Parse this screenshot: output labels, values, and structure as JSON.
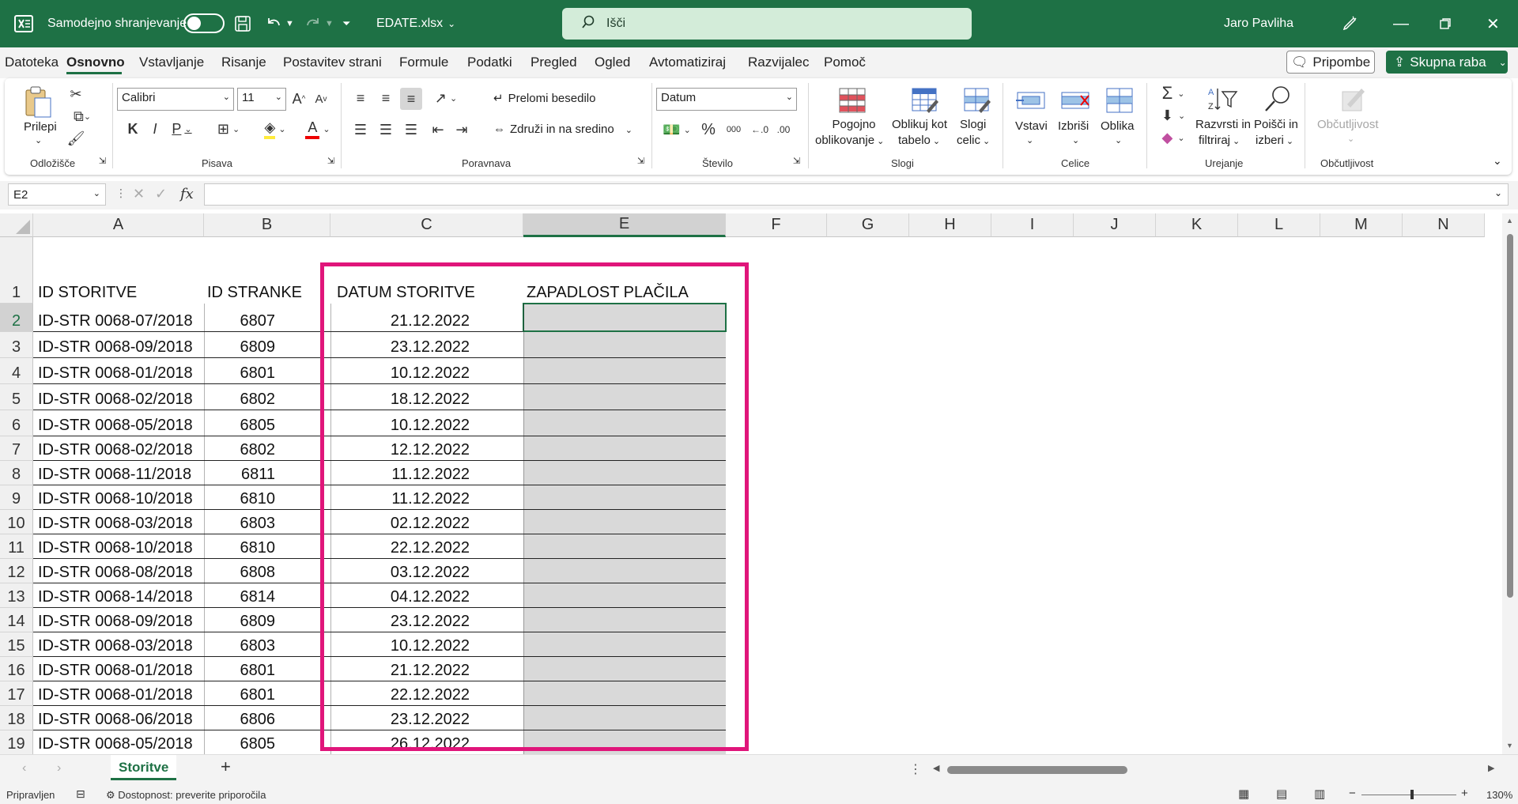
{
  "titlebar": {
    "autosave_label": "Samodejno shranjevanje",
    "filename": "EDATE.xlsx",
    "search_placeholder": "Išči",
    "user": "Jaro Pavliha"
  },
  "menu": [
    "Datoteka",
    "Osnovno",
    "Vstavljanje",
    "Risanje",
    "Postavitev strani",
    "Formule",
    "Podatki",
    "Pregled",
    "Ogled",
    "Avtomatiziraj",
    "Razvijalec",
    "Pomoč"
  ],
  "menu_active": "Osnovno",
  "comments_label": "Pripombe",
  "share_label": "Skupna raba",
  "ribbon": {
    "paste": "Prilepi",
    "clipboard": "Odložišče",
    "font_name": "Calibri",
    "font_size": "11",
    "font": "Pisava",
    "bold": "K",
    "italic": "I",
    "underline": "P",
    "wrap_text": "Prelomi besedilo",
    "merge_center": "Združi in na sredino",
    "alignment": "Poravnava",
    "number_format": "Datum",
    "number": "Število",
    "percent": "%",
    "thousands": "000",
    "cond_format_1": "Pogojno",
    "cond_format_2": "oblikovanje",
    "format_table_1": "Oblikuj kot",
    "format_table_2": "tabelo",
    "cell_styles_1": "Slogi",
    "cell_styles_2": "celic",
    "styles": "Slogi",
    "insert": "Vstavi",
    "delete": "Izbriši",
    "format": "Oblika",
    "cells": "Celice",
    "sort_1": "Razvrsti in",
    "sort_2": "filtriraj",
    "find_1": "Poišči in",
    "find_2": "izberi",
    "editing": "Urejanje",
    "sensitivity": "Občutljivost",
    "sensitivity_group": "Občutljivost"
  },
  "formula_bar": {
    "name_box": "E2",
    "fx": "fx",
    "formula": ""
  },
  "columns": [
    "A",
    "B",
    "C",
    "E",
    "F",
    "G",
    "H",
    "I",
    "J",
    "K",
    "L",
    "M",
    "N"
  ],
  "selected_column": "E",
  "headers": {
    "A": "ID STORITVE",
    "B": "ID STRANKE",
    "C": "DATUM STORITVE",
    "E": "ZAPADLOST PLAČILA"
  },
  "rows": [
    {
      "n": "1"
    },
    {
      "n": "2",
      "a": "ID-STR 0068-07/2018",
      "b": "6807",
      "c": "21.12.2022"
    },
    {
      "n": "3",
      "a": "ID-STR 0068-09/2018",
      "b": "6809",
      "c": "23.12.2022"
    },
    {
      "n": "4",
      "a": "ID-STR 0068-01/2018",
      "b": "6801",
      "c": "10.12.2022"
    },
    {
      "n": "5",
      "a": "ID-STR 0068-02/2018",
      "b": "6802",
      "c": "18.12.2022"
    },
    {
      "n": "6",
      "a": "ID-STR 0068-05/2018",
      "b": "6805",
      "c": "10.12.2022"
    },
    {
      "n": "7",
      "a": "ID-STR 0068-02/2018",
      "b": "6802",
      "c": "12.12.2022"
    },
    {
      "n": "8",
      "a": "ID-STR 0068-11/2018",
      "b": "6811",
      "c": "11.12.2022"
    },
    {
      "n": "9",
      "a": "ID-STR 0068-10/2018",
      "b": "6810",
      "c": "11.12.2022"
    },
    {
      "n": "10",
      "a": "ID-STR 0068-03/2018",
      "b": "6803",
      "c": "02.12.2022"
    },
    {
      "n": "11",
      "a": "ID-STR 0068-10/2018",
      "b": "6810",
      "c": "22.12.2022"
    },
    {
      "n": "12",
      "a": "ID-STR 0068-08/2018",
      "b": "6808",
      "c": "03.12.2022"
    },
    {
      "n": "13",
      "a": "ID-STR 0068-14/2018",
      "b": "6814",
      "c": "04.12.2022"
    },
    {
      "n": "14",
      "a": "ID-STR 0068-09/2018",
      "b": "6809",
      "c": "23.12.2022"
    },
    {
      "n": "15",
      "a": "ID-STR 0068-03/2018",
      "b": "6803",
      "c": "10.12.2022"
    },
    {
      "n": "16",
      "a": "ID-STR 0068-01/2018",
      "b": "6801",
      "c": "21.12.2022"
    },
    {
      "n": "17",
      "a": "ID-STR 0068-01/2018",
      "b": "6801",
      "c": "22.12.2022"
    },
    {
      "n": "18",
      "a": "ID-STR 0068-06/2018",
      "b": "6806",
      "c": "23.12.2022"
    },
    {
      "n": "19",
      "a": "ID-STR 0068-05/2018",
      "b": "6805",
      "c": "26.12.2022"
    }
  ],
  "sheet_tab": "Storitve",
  "status": {
    "ready": "Pripravljen",
    "accessibility": "Dostopnost: preverite priporočila",
    "zoom": "130%"
  },
  "colors": {
    "brand": "#1e7145",
    "highlight_frame": "#e0157a",
    "cell_fill": "#d9d9d9"
  }
}
